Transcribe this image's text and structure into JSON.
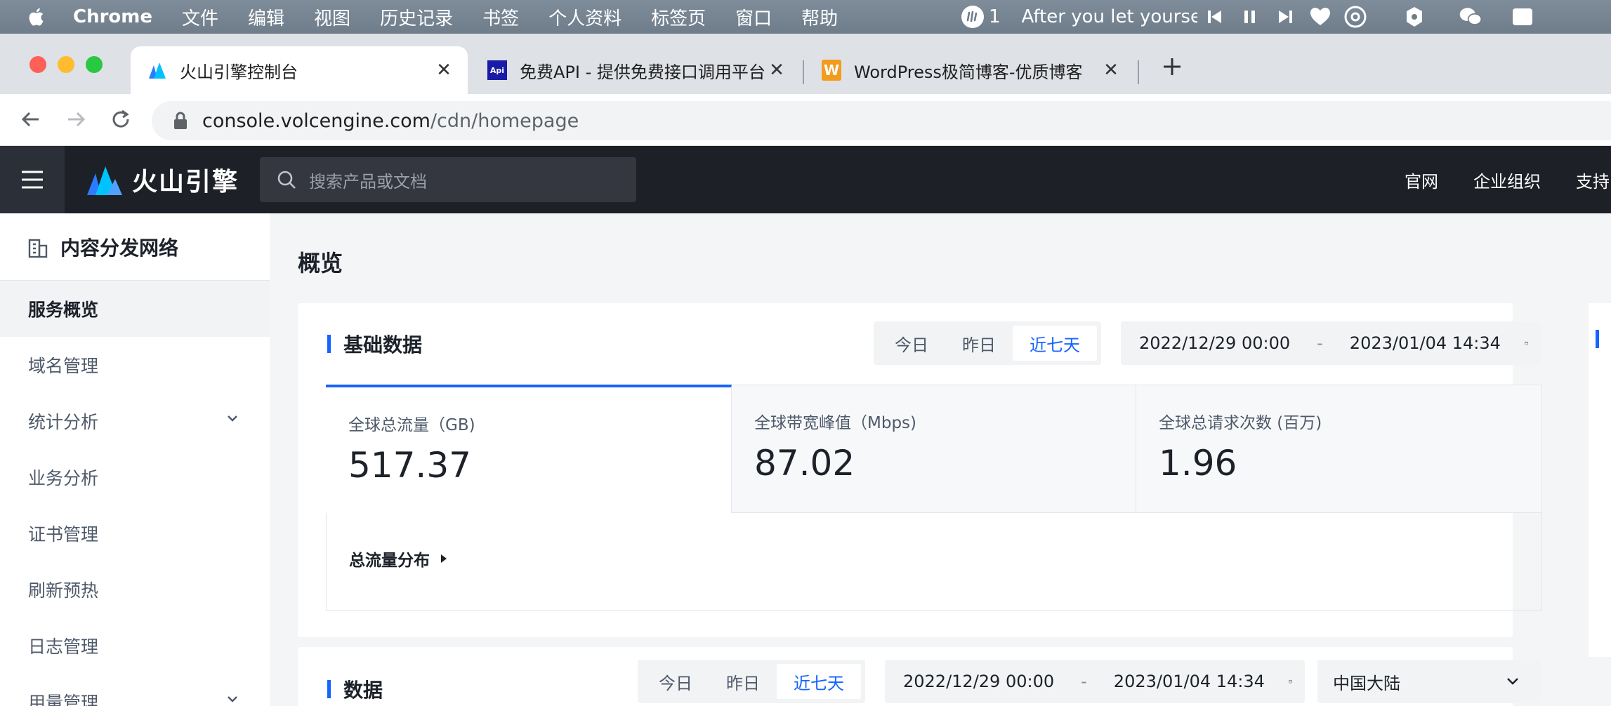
{
  "menubar": {
    "items": [
      "Chrome",
      "文件",
      "编辑",
      "视图",
      "历史记录",
      "书签",
      "个人资料",
      "标签页",
      "窗口",
      "帮助"
    ],
    "notif_count": "1",
    "now_playing": "After you let yourself come undone"
  },
  "tabs": [
    {
      "title": "火山引擎控制台",
      "favicon": "volcengine-logo"
    },
    {
      "title": "免费API - 提供免费接口调用平台",
      "favicon": "api-icon",
      "favicon_text": "Api"
    },
    {
      "title": "WordPress极简博客-优质博客",
      "favicon": "wordpress-w-icon",
      "favicon_text": "W"
    }
  ],
  "address": {
    "host": "console.volcengine.com",
    "path": "/cdn/homepage"
  },
  "header": {
    "brand": "火山引擎",
    "search_placeholder": "搜索产品或文档",
    "links": [
      "官网",
      "企业组织",
      "支持"
    ]
  },
  "sidebar": {
    "title": "内容分发网络",
    "items": [
      {
        "label": "服务概览",
        "active": true
      },
      {
        "label": "域名管理"
      },
      {
        "label": "统计分析",
        "expandable": true
      },
      {
        "label": "业务分析"
      },
      {
        "label": "证书管理"
      },
      {
        "label": "刷新预热"
      },
      {
        "label": "日志管理"
      },
      {
        "label": "用量管理",
        "expandable": true
      }
    ]
  },
  "main": {
    "page_title": "概览",
    "basic": {
      "title": "基础数据",
      "ranges": [
        "今日",
        "昨日",
        "近七天"
      ],
      "selected_range": "近七天",
      "date_start": "2022/12/29 00:00",
      "date_sep": "-",
      "date_end": "2023/01/04 14:34",
      "metrics": [
        {
          "label": "全球总流量（GB)",
          "value": "517.37"
        },
        {
          "label": "全球带宽峰值（Mbps)",
          "value": "87.02"
        },
        {
          "label": "全球总请求次数 (百万)",
          "value": "1.96"
        }
      ],
      "distribution_label": "总流量分布"
    },
    "second": {
      "title": "数据",
      "ranges": [
        "今日",
        "昨日",
        "近七天"
      ],
      "date_start": "2022/12/29 00:00",
      "date_sep": "-",
      "date_end": "2023/01/04 14:34",
      "region": "中国大陆"
    }
  },
  "colors": {
    "accent": "#1664ff",
    "header_bg": "#1d2026"
  }
}
